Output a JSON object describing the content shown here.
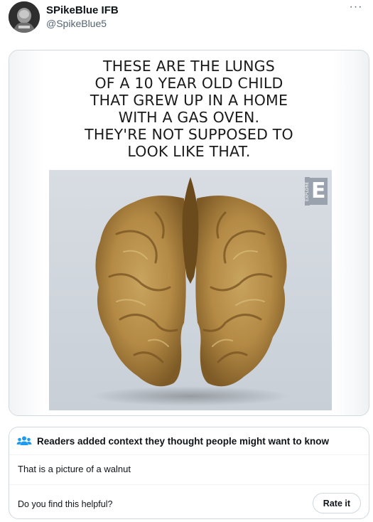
{
  "user": {
    "display_name": "SPikeBlue IFB",
    "handle": "@SpikeBlue5",
    "avatar_icon": "avatar-photo"
  },
  "header": {
    "more_label": "···"
  },
  "media": {
    "caption_lines": [
      "THESE ARE THE LUNGS",
      "OF A 10 YEAR OLD CHILD",
      "THAT GREW UP IN A HOME",
      "WITH A GAS OVEN.",
      "THEY'RE NOT SUPPOSED TO",
      "LOOK LIKE THAT."
    ],
    "watermark_letter": "E",
    "watermark_side": "EXPLORE"
  },
  "community_note": {
    "title": "Readers added context they thought people might want to know",
    "title_icon": "people-icon",
    "body": "That is a picture of a walnut",
    "question": "Do you find this helpful?",
    "rate_label": "Rate it"
  },
  "colors": {
    "text_primary": "#0f1419",
    "text_secondary": "#536471",
    "border": "#cfd9de",
    "note_icon": "#1d9bf0"
  }
}
